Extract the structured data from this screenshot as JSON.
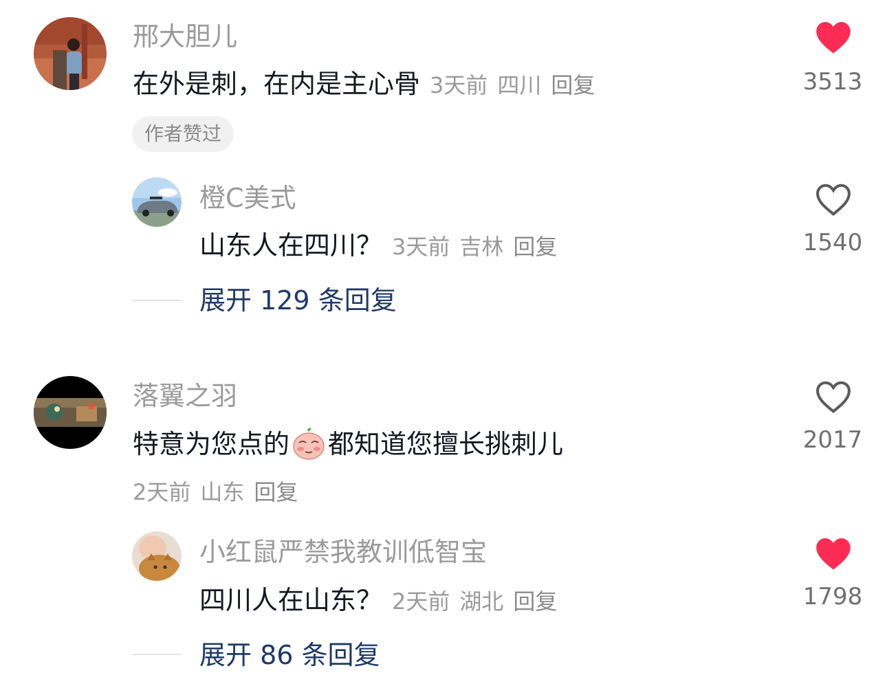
{
  "comments": [
    {
      "username": "邢大胆儿",
      "text": "在外是刺，在内是主心骨",
      "time": "3天前",
      "location": "四川",
      "reply_label": "回复",
      "badge": "作者赞过",
      "likes": "3513",
      "liked": true,
      "replies": [
        {
          "username": "橙C美式",
          "text": "山东人在四川？",
          "time": "3天前",
          "location": "吉林",
          "reply_label": "回复",
          "likes": "1540",
          "liked": false
        }
      ],
      "expand_label": "展开 129 条回复"
    },
    {
      "username": "落翼之羽",
      "text_before": "特意为您点的",
      "emoji": "blushing-face-emoji",
      "text_after": "都知道您擅长挑刺儿",
      "time": "2天前",
      "location": "山东",
      "reply_label": "回复",
      "likes": "2017",
      "liked": false,
      "replies": [
        {
          "username": "小红鼠严禁我教训低智宝",
          "text": "四川人在山东？",
          "time": "2天前",
          "location": "湖北",
          "reply_label": "回复",
          "likes": "1798",
          "liked": true
        }
      ],
      "expand_label": "展开 86 条回复"
    }
  ],
  "colors": {
    "liked_heart": "#fe2c55",
    "unliked_heart": "#5b5b5f",
    "expand_link": "#1f3a68"
  }
}
